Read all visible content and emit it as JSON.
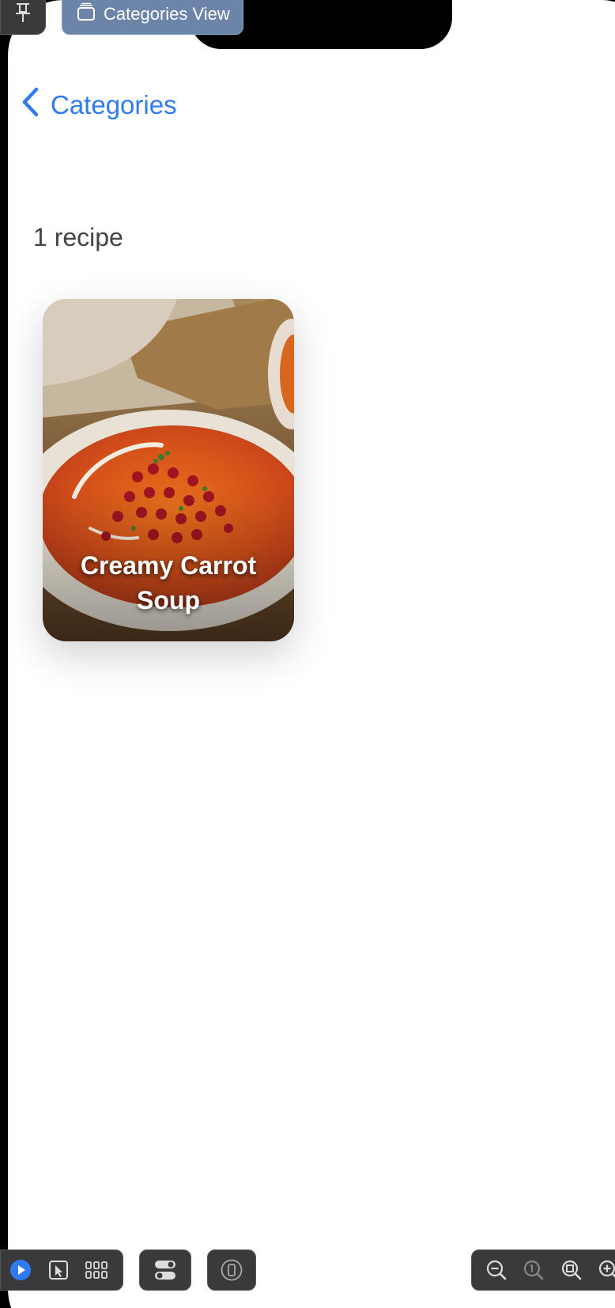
{
  "preview": {
    "label": "Categories View"
  },
  "nav": {
    "back_label": "Categories"
  },
  "content": {
    "recipe_count": "1 recipe",
    "recipes": [
      {
        "title": "Creamy Carrot Soup"
      }
    ]
  },
  "icons": {
    "pin": "pin-icon",
    "preview_window": "window-stack-icon",
    "back": "chevron-left-icon",
    "live": "play-icon",
    "select": "cursor-select-icon",
    "variants": "grid-icon",
    "settings": "toggle-settings-icon",
    "device": "device-icon",
    "zoom_out": "zoom-out-icon",
    "zoom_100": "zoom-actual-size-icon",
    "zoom_fit": "zoom-fit-icon",
    "zoom_in": "zoom-in-icon"
  },
  "colors": {
    "accent": "#2f7bf5",
    "play_active": "#2f7bf5",
    "label_bg": "#6c84a8",
    "toolbar_bg": "#3a3a3c"
  }
}
